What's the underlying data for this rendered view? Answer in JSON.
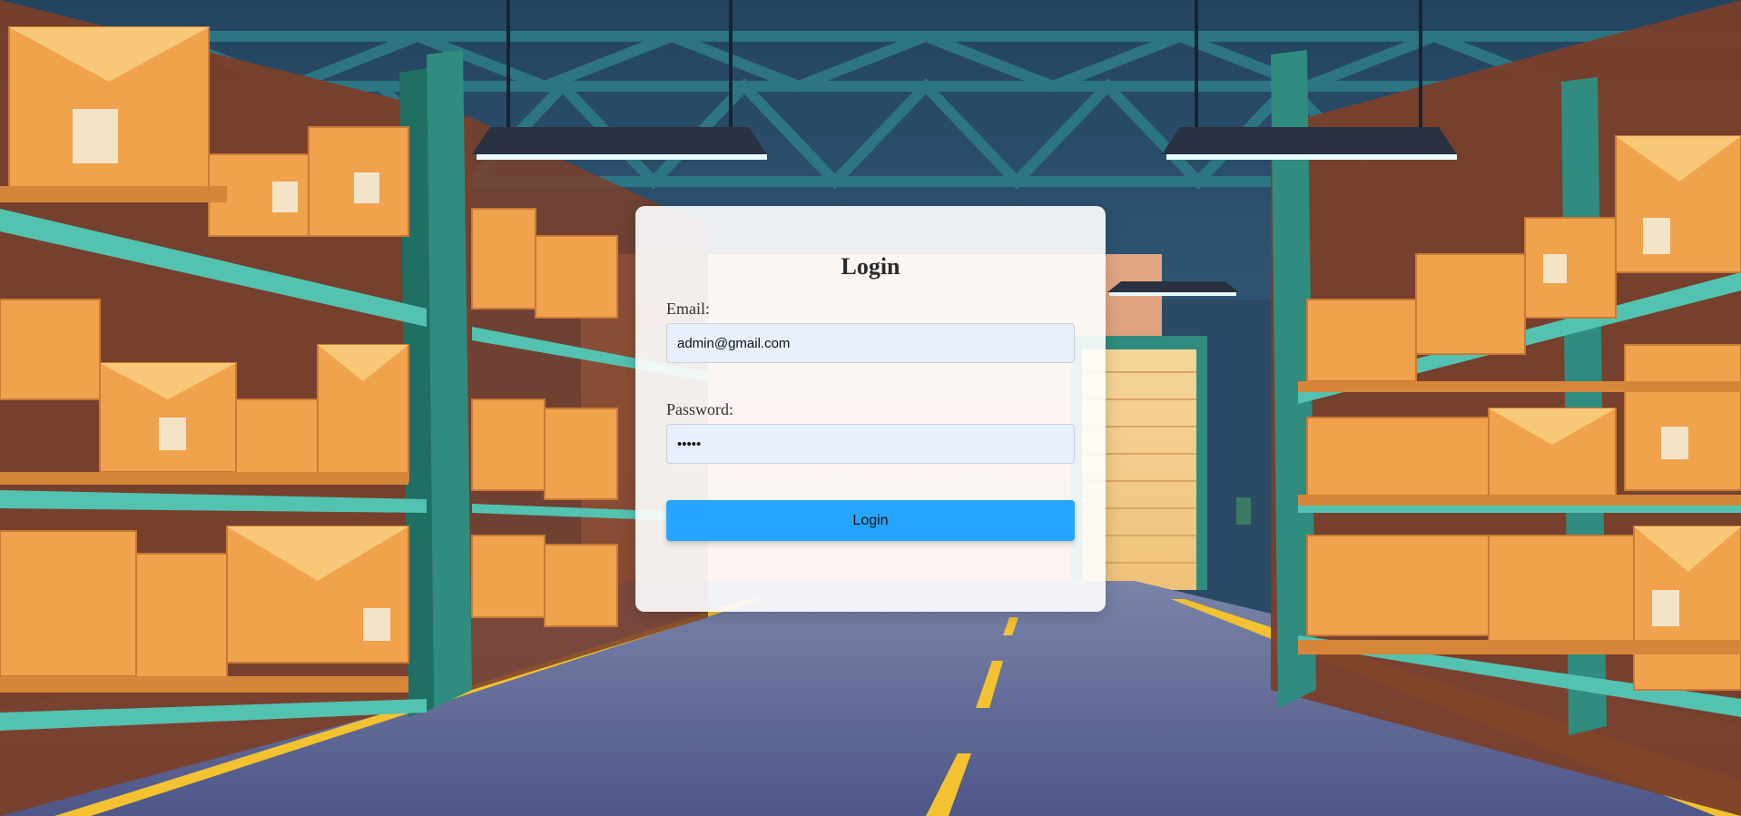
{
  "login": {
    "title": "Login",
    "email_label": "Email:",
    "email_value": "admin@gmail.com",
    "password_label": "Password:",
    "password_value": "•••••",
    "button_label": "Login"
  },
  "colors": {
    "button": "#26a4ff",
    "input_bg": "#e8f0fe",
    "card_bg": "#ffffff"
  }
}
